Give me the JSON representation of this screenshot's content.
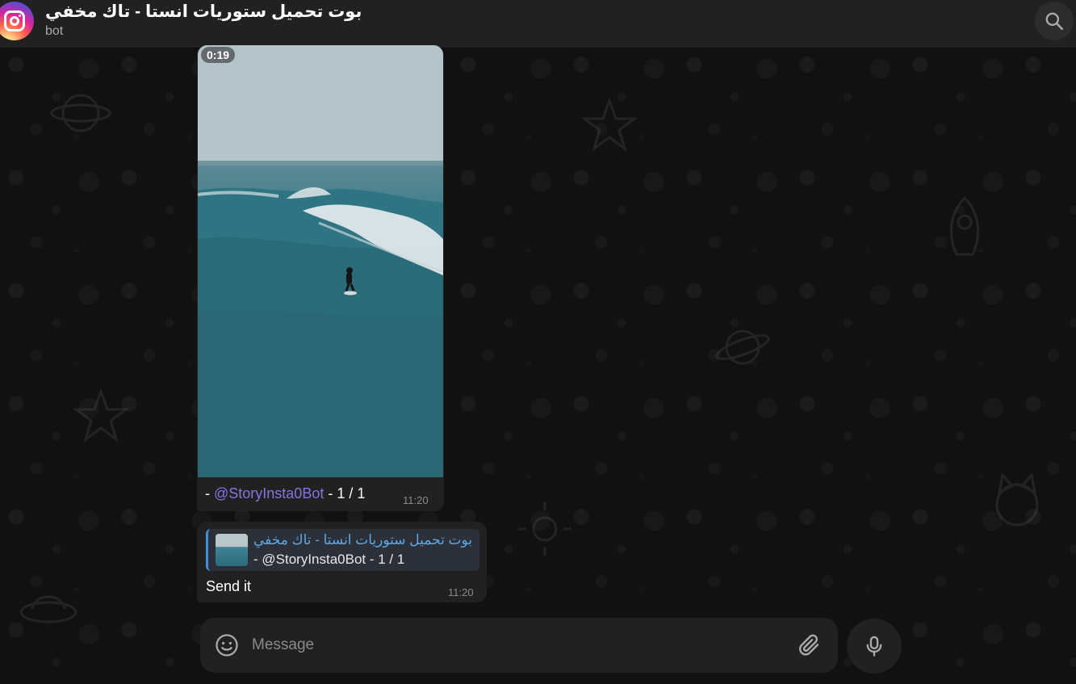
{
  "header": {
    "title": "بوت تحميل ستوريات انستا - تاك مخفي",
    "status": "bot",
    "avatar_icon": "instagram-icon",
    "search_icon": "search-icon"
  },
  "messages": [
    {
      "type": "video",
      "duration": "0:19",
      "caption_prefix": "- ",
      "caption_link": "@StoryInsta0Bot",
      "caption_suffix": " - 1 / 1",
      "time": "11:20"
    },
    {
      "type": "reply",
      "reply_title": "بوت تحميل ستوريات انستا - تاك مخفي",
      "reply_text": "- @StoryInsta0Bot - 1 / 1",
      "text": "Send it",
      "time": "11:20"
    }
  ],
  "composer": {
    "placeholder": "Message",
    "emoji_icon": "smile-icon",
    "attach_icon": "paperclip-icon",
    "mic_icon": "microphone-icon"
  },
  "colors": {
    "accent": "#8774e1",
    "reply_accent": "#5ea7e6",
    "bubble": "#212121",
    "header": "#212121"
  }
}
